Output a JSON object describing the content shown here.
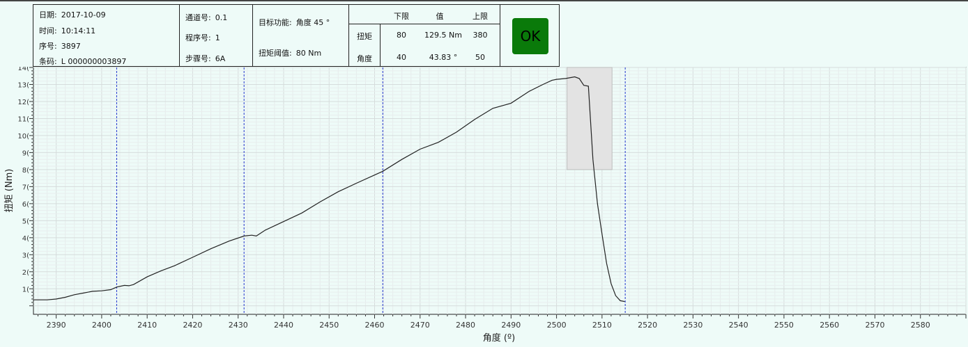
{
  "info": {
    "date_label": "日期:",
    "date_value": "2017-10-09",
    "time_label": "时间:",
    "time_value": "10:14:11",
    "seq_label": "序号:",
    "seq_value": "3897",
    "barcode_label": "条码:",
    "barcode_value": "L 000000003897",
    "channel_label": "通道号:",
    "channel_value": "0.1",
    "program_label": "程序号:",
    "program_value": "1",
    "step_label": "步骤号:",
    "step_value": "6A",
    "target_label": "目标功能:",
    "target_value": "角度  45 °",
    "threshold_label": "扭矩阈值:",
    "threshold_value": "80  Nm"
  },
  "limits": {
    "header": {
      "lower": "下限",
      "value": "值",
      "upper": "上限"
    },
    "torque": {
      "label": "扭矩",
      "lower": "80",
      "value": "129.5 Nm",
      "upper": "380"
    },
    "angle": {
      "label": "角度",
      "lower": "40",
      "value": "43.83 °",
      "upper": "50"
    }
  },
  "status": {
    "text": "OK",
    "color": "#0a7a0a"
  },
  "chart_data": {
    "type": "line",
    "xlabel": "角度 (º)",
    "ylabel": "扭矩 (Nm)",
    "xlim": [
      2385,
      2590
    ],
    "ylim": [
      -0.5,
      14
    ],
    "x_ticks": [
      2390,
      2400,
      2410,
      2420,
      2430,
      2440,
      2450,
      2460,
      2470,
      2480,
      2490,
      2500,
      2510,
      2520,
      2530,
      2540,
      2550,
      2560,
      2570,
      2580
    ],
    "y_ticks": [
      0,
      1,
      2,
      3,
      4,
      5,
      6,
      7,
      8,
      9,
      10,
      11,
      12,
      13,
      14
    ],
    "y_tick_labels": [
      "",
      "1(",
      "2(",
      "3(",
      "4(",
      "5(",
      "6(",
      "7(",
      "8(",
      "9(",
      "10(",
      "11(",
      "12(",
      "13(",
      "14("
    ],
    "grid": true,
    "line_color": "#222222",
    "marker_color": "#2233cc",
    "vertical_markers": [
      2403.3,
      2431.3,
      2461.8,
      2515.1
    ],
    "window": {
      "x": [
        2502.3,
        2512.2
      ],
      "y": [
        8,
        14
      ]
    },
    "series": [
      {
        "x": [
          2385,
          2388,
          2390,
          2392,
          2394,
          2396,
          2398,
          2400,
          2402,
          2403.3,
          2405,
          2406,
          2407,
          2410,
          2413,
          2416,
          2420,
          2424,
          2428,
          2431.3,
          2433,
          2434,
          2436,
          2440,
          2444,
          2448,
          2452,
          2456,
          2461.8,
          2466,
          2470,
          2474,
          2478,
          2482,
          2486,
          2490,
          2494,
          2497,
          2499,
          2500,
          2502,
          2504,
          2505,
          2506,
          2507,
          2508,
          2509,
          2510,
          2511,
          2512,
          2513,
          2514,
          2515
        ],
        "y": [
          0.35,
          0.35,
          0.4,
          0.5,
          0.65,
          0.75,
          0.85,
          0.88,
          0.95,
          1.1,
          1.2,
          1.18,
          1.25,
          1.7,
          2.05,
          2.35,
          2.85,
          3.35,
          3.8,
          4.1,
          4.15,
          4.1,
          4.45,
          4.95,
          5.45,
          6.1,
          6.7,
          7.2,
          7.9,
          8.6,
          9.2,
          9.6,
          10.2,
          10.95,
          11.6,
          11.9,
          12.6,
          13.0,
          13.25,
          13.3,
          13.35,
          13.45,
          13.35,
          12.95,
          12.9,
          8.6,
          6.0,
          4.2,
          2.5,
          1.3,
          0.6,
          0.3,
          0.25
        ]
      }
    ]
  }
}
